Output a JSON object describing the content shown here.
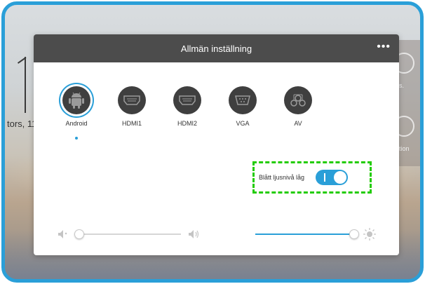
{
  "background": {
    "date_fragment": "tors, 11",
    "tile_texts": [
      "s.",
      "tion"
    ]
  },
  "dialog": {
    "title": "Allmän inställning",
    "more_label": "•••"
  },
  "sources": [
    {
      "label": "Android",
      "icon": "android-icon",
      "selected": true
    },
    {
      "label": "HDMI1",
      "icon": "hdmi-icon",
      "selected": false
    },
    {
      "label": "HDMI2",
      "icon": "hdmi-icon",
      "selected": false
    },
    {
      "label": "VGA",
      "icon": "vga-icon",
      "selected": false
    },
    {
      "label": "AV",
      "icon": "av-icon",
      "selected": false
    }
  ],
  "blue_light": {
    "label": "Blått ljusnivå låg",
    "enabled": true
  },
  "volume": {
    "icon_low": "speaker-low-icon",
    "icon_high": "speaker-high-icon",
    "level": 0.0
  },
  "brightness": {
    "icon_low": "moon-icon",
    "icon_high": "sun-icon",
    "level": 1.0
  },
  "colors": {
    "accent": "#2a9fd8",
    "header": "#4c4c4c",
    "highlight": "#22cc00"
  }
}
